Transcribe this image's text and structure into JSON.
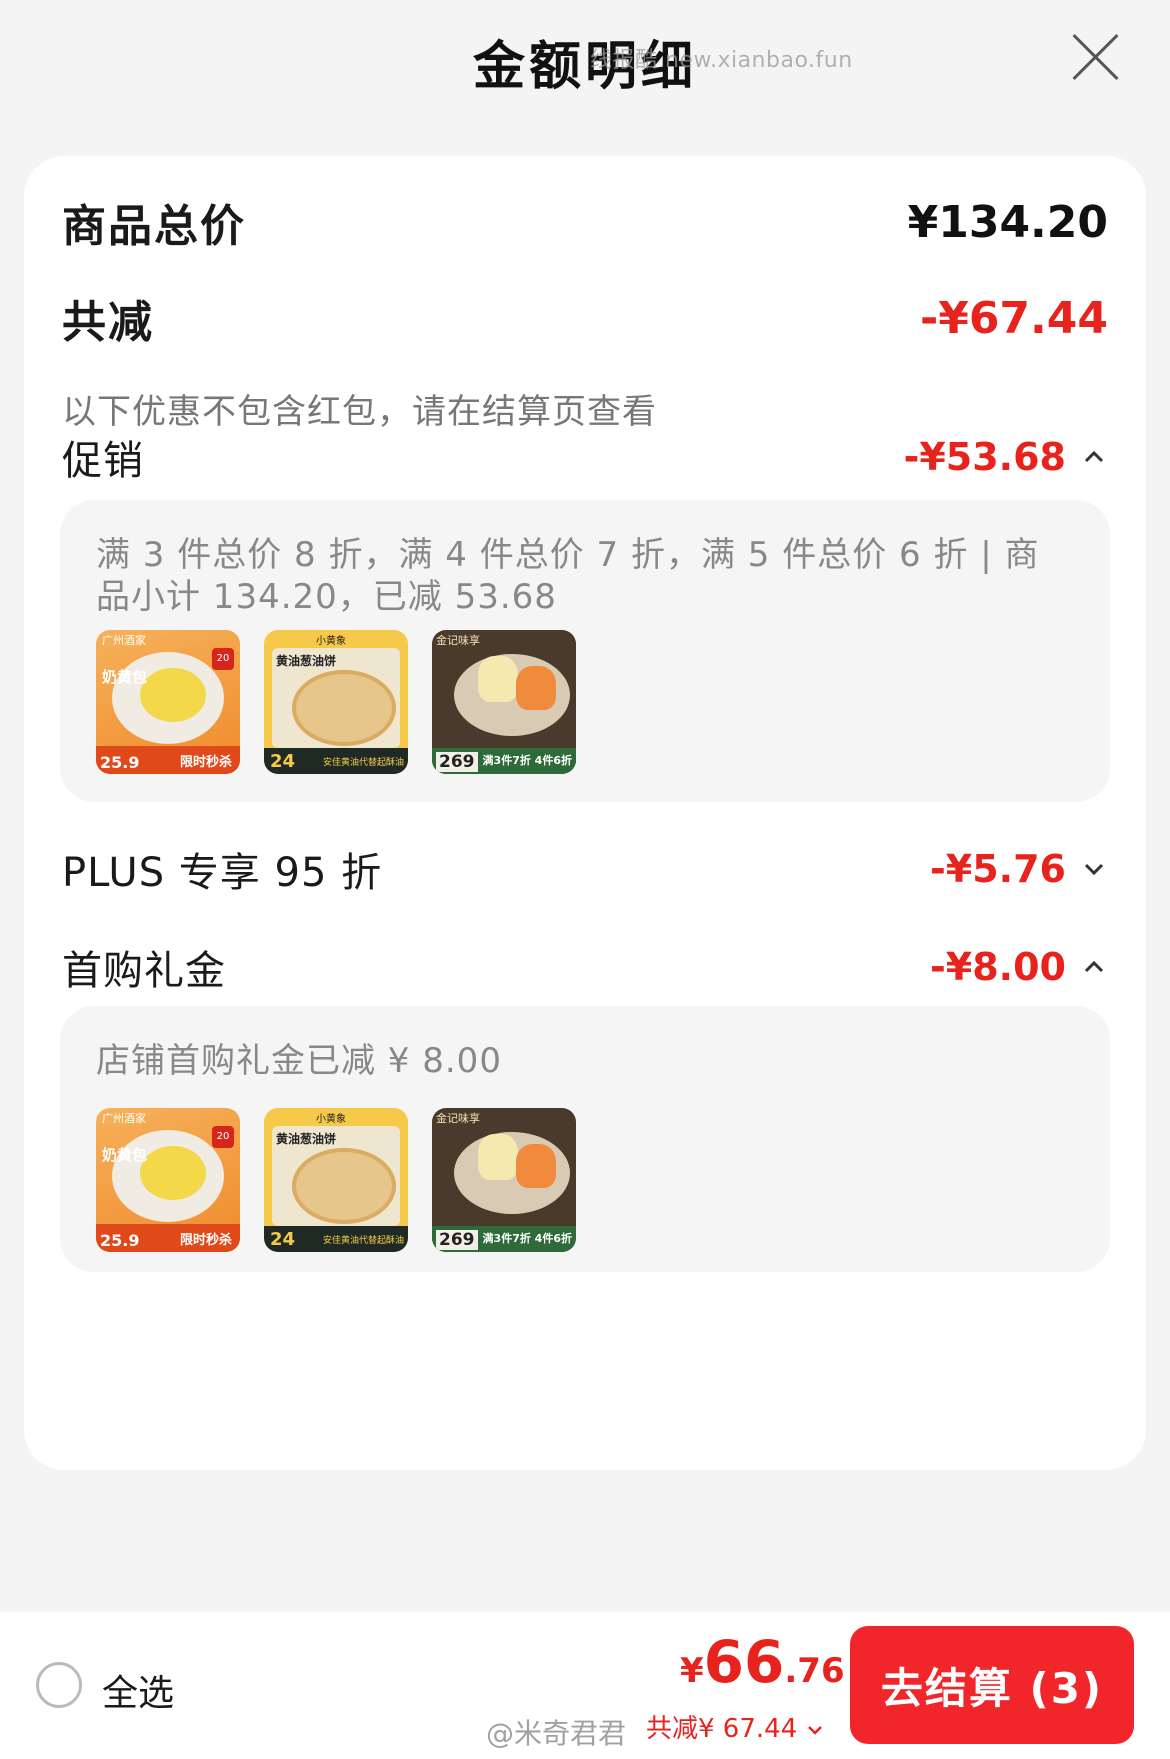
{
  "header": {
    "title": "金额明细",
    "watermark": "线报酷 new.xianbao.fun"
  },
  "summary": {
    "total_label": "商品总价",
    "total_value": "¥134.20",
    "discount_label": "共减",
    "discount_value": "-¥67.44",
    "note": "以下优惠不包含红包，请在结算页查看"
  },
  "promo": {
    "label": "促销",
    "value": "-¥53.68",
    "detail": "满 3 件总价 8 折，满 4 件总价 7 折，满 5 件总价 6 折 | 商品小计 134.20，已减 53.68"
  },
  "plus": {
    "label": "PLUS 专享 95 折",
    "value": "-¥5.76"
  },
  "firstbuy": {
    "label": "首购礼金",
    "value": "-¥8.00",
    "detail": "店铺首购礼金已减 ¥ 8.00"
  },
  "products": [
    {
      "brand": "广州酒家",
      "name": "奶黄包",
      "badge": "20",
      "price": "25.9",
      "tag": "限时秒杀"
    },
    {
      "brand": "小黄象",
      "name": "黄油葱油饼",
      "price": "24",
      "tag": "安佳黄油代替起酥油"
    },
    {
      "brand": "金记味享",
      "price": "269",
      "tag": "满3件7折 4件6折"
    }
  ],
  "bottom": {
    "select_all": "全选",
    "total_currency": "¥",
    "total_int": "66",
    "total_dec": ".76",
    "saved": "共减¥ 67.44",
    "checkout": "去结算 (3)",
    "watermark": "@米奇君君"
  },
  "colors": {
    "accent": "#e8231d",
    "button": "#f0262a"
  }
}
